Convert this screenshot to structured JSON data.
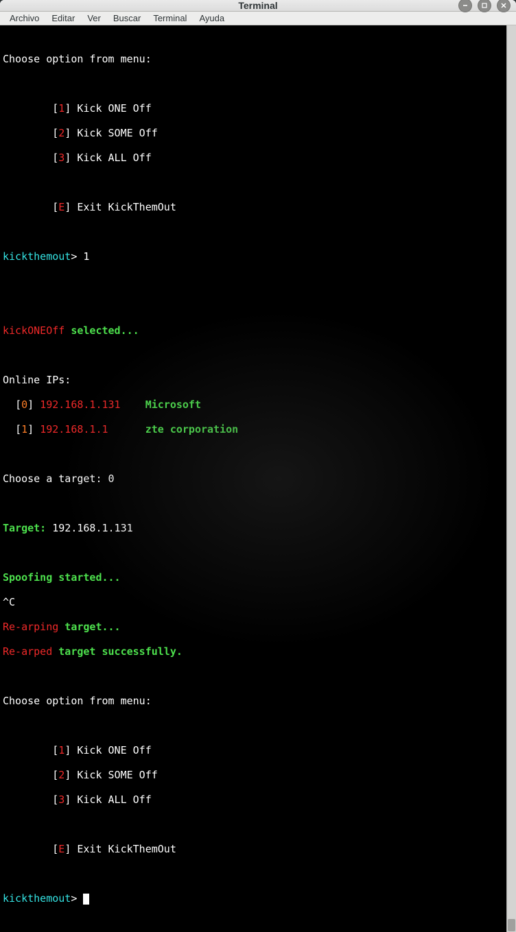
{
  "window": {
    "title": "Terminal"
  },
  "menu": {
    "archivo": "Archivo",
    "editar": "Editar",
    "ver": "Ver",
    "buscar": "Buscar",
    "terminal": "Terminal",
    "ayuda": "Ayuda"
  },
  "t": {
    "choose_menu": "Choose option from menu:",
    "lb": "[",
    "rb": "]",
    "opt1": "1",
    "opt2": "2",
    "opt3": "3",
    "optE": "E",
    "kick_one": " Kick ONE Off",
    "kick_some": " Kick SOME Off",
    "kick_all": " Kick ALL Off",
    "exit": " Exit KickThemOut",
    "prompt_name": "kickthemout",
    "prompt_gt": "> ",
    "input1": "1",
    "kickone": "kickONEOff",
    "selected": " selected...",
    "online_ips": "Online IPs: ",
    "sp3": "  ",
    "idx0": "0",
    "idx1": "1",
    "ip0": "192.168.1.131",
    "ip1": "192.168.1.1  ",
    "gap1": "    ",
    "gap2": "    ",
    "vendor0": "Microsoft",
    "vendor1": "zte corporation",
    "choose_target": "Choose a target: ",
    "target_idx": "0",
    "target_lbl": "Target:",
    "target_ip": " 192.168.1.131",
    "spoof": "Spoofing started...",
    "ctrlc": "^C",
    "rearping": "Re-arping",
    "rearping_tail": " target...",
    "rearped": "Re-arped",
    "rearped_tail": " target successfully.",
    "space": " ",
    "indent8": "        "
  }
}
